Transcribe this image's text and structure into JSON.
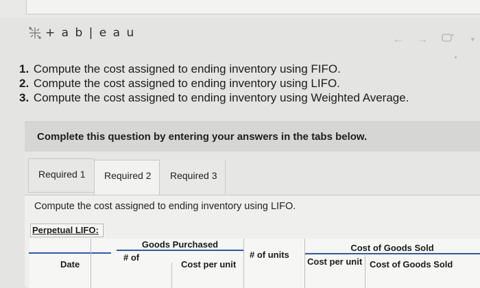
{
  "logo": {
    "text": "+ a b | e a u",
    "icon": "tableau-logo-icon"
  },
  "nav": {
    "back": "←",
    "forward": "→",
    "refresh": "refresh-icon",
    "dropdown": "▾"
  },
  "instructions": [
    {
      "num": "1.",
      "text": "Compute the cost assigned to ending inventory using FIFO."
    },
    {
      "num": "2.",
      "text": "Compute the cost assigned to ending inventory using LIFO."
    },
    {
      "num": "3.",
      "text": "Compute the cost assigned to ending inventory using Weighted Average."
    }
  ],
  "banner": {
    "text": "Complete this question by entering your answers in the tabs below."
  },
  "tabs": [
    {
      "label": "Required 1"
    },
    {
      "label": "Required 2"
    },
    {
      "label": "Required 3"
    }
  ],
  "panel": {
    "text": "Compute the cost assigned to ending inventory using LIFO.",
    "section_label": "Perpetual LIFO:"
  },
  "table": {
    "goods_purchased": "Goods Purchased",
    "cost_of_goods_sold": "Cost of Goods Sold",
    "date": "Date",
    "num_of_units_left": "# of",
    "cost_per_unit_left": "Cost per unit",
    "num_of_units_mid": "# of units",
    "cost_per_unit_right": "Cost per unit",
    "cogs_col": "Cost of Goods Sold"
  },
  "colors": {
    "accent_blue": "#2e56b8"
  }
}
